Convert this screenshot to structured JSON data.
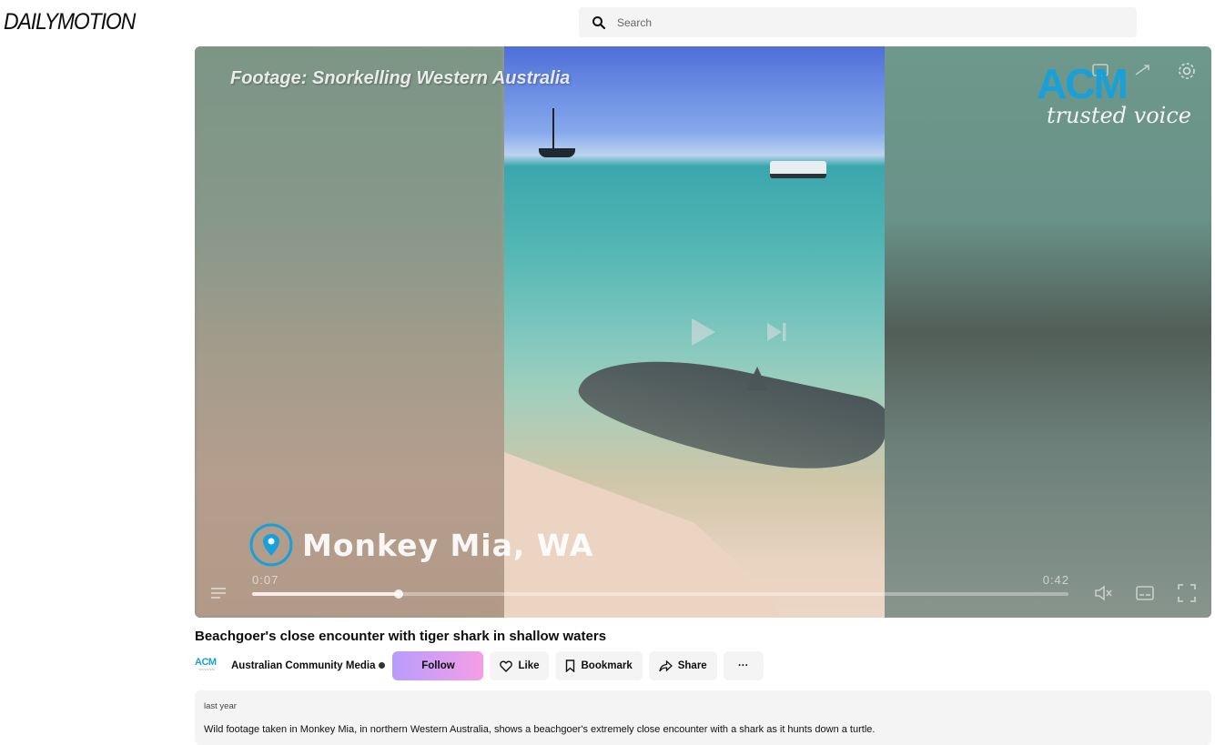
{
  "header": {
    "logo": "DAILYMOTION",
    "search_placeholder": "Search"
  },
  "player": {
    "overlay_caption": "Footage: Snorkelling Western Australia",
    "brand_logo": "ACM",
    "brand_tagline": "trusted voice",
    "location_label": "Monkey Mia, WA",
    "time_current": "0:07",
    "time_total": "0:42",
    "progress_fraction": 0.18
  },
  "video": {
    "title": "Beachgoer's close encounter with tiger shark in shallow waters",
    "channel_logo": "ACM",
    "channel_name": "Australian Community Media",
    "follow_label": "Follow",
    "like_label": "Like",
    "bookmark_label": "Bookmark",
    "share_label": "Share",
    "more_label": "···"
  },
  "description": {
    "date": "last year",
    "text": "Wild footage taken in Monkey Mia, in northern Western Australia, shows a beachgoer's extremely close encounter with a shark as it hunts down a turtle."
  },
  "colors": {
    "accent_blue": "#1aa0d8",
    "follow_gradient_start": "#b79dfc",
    "follow_gradient_end": "#f59ee6"
  }
}
